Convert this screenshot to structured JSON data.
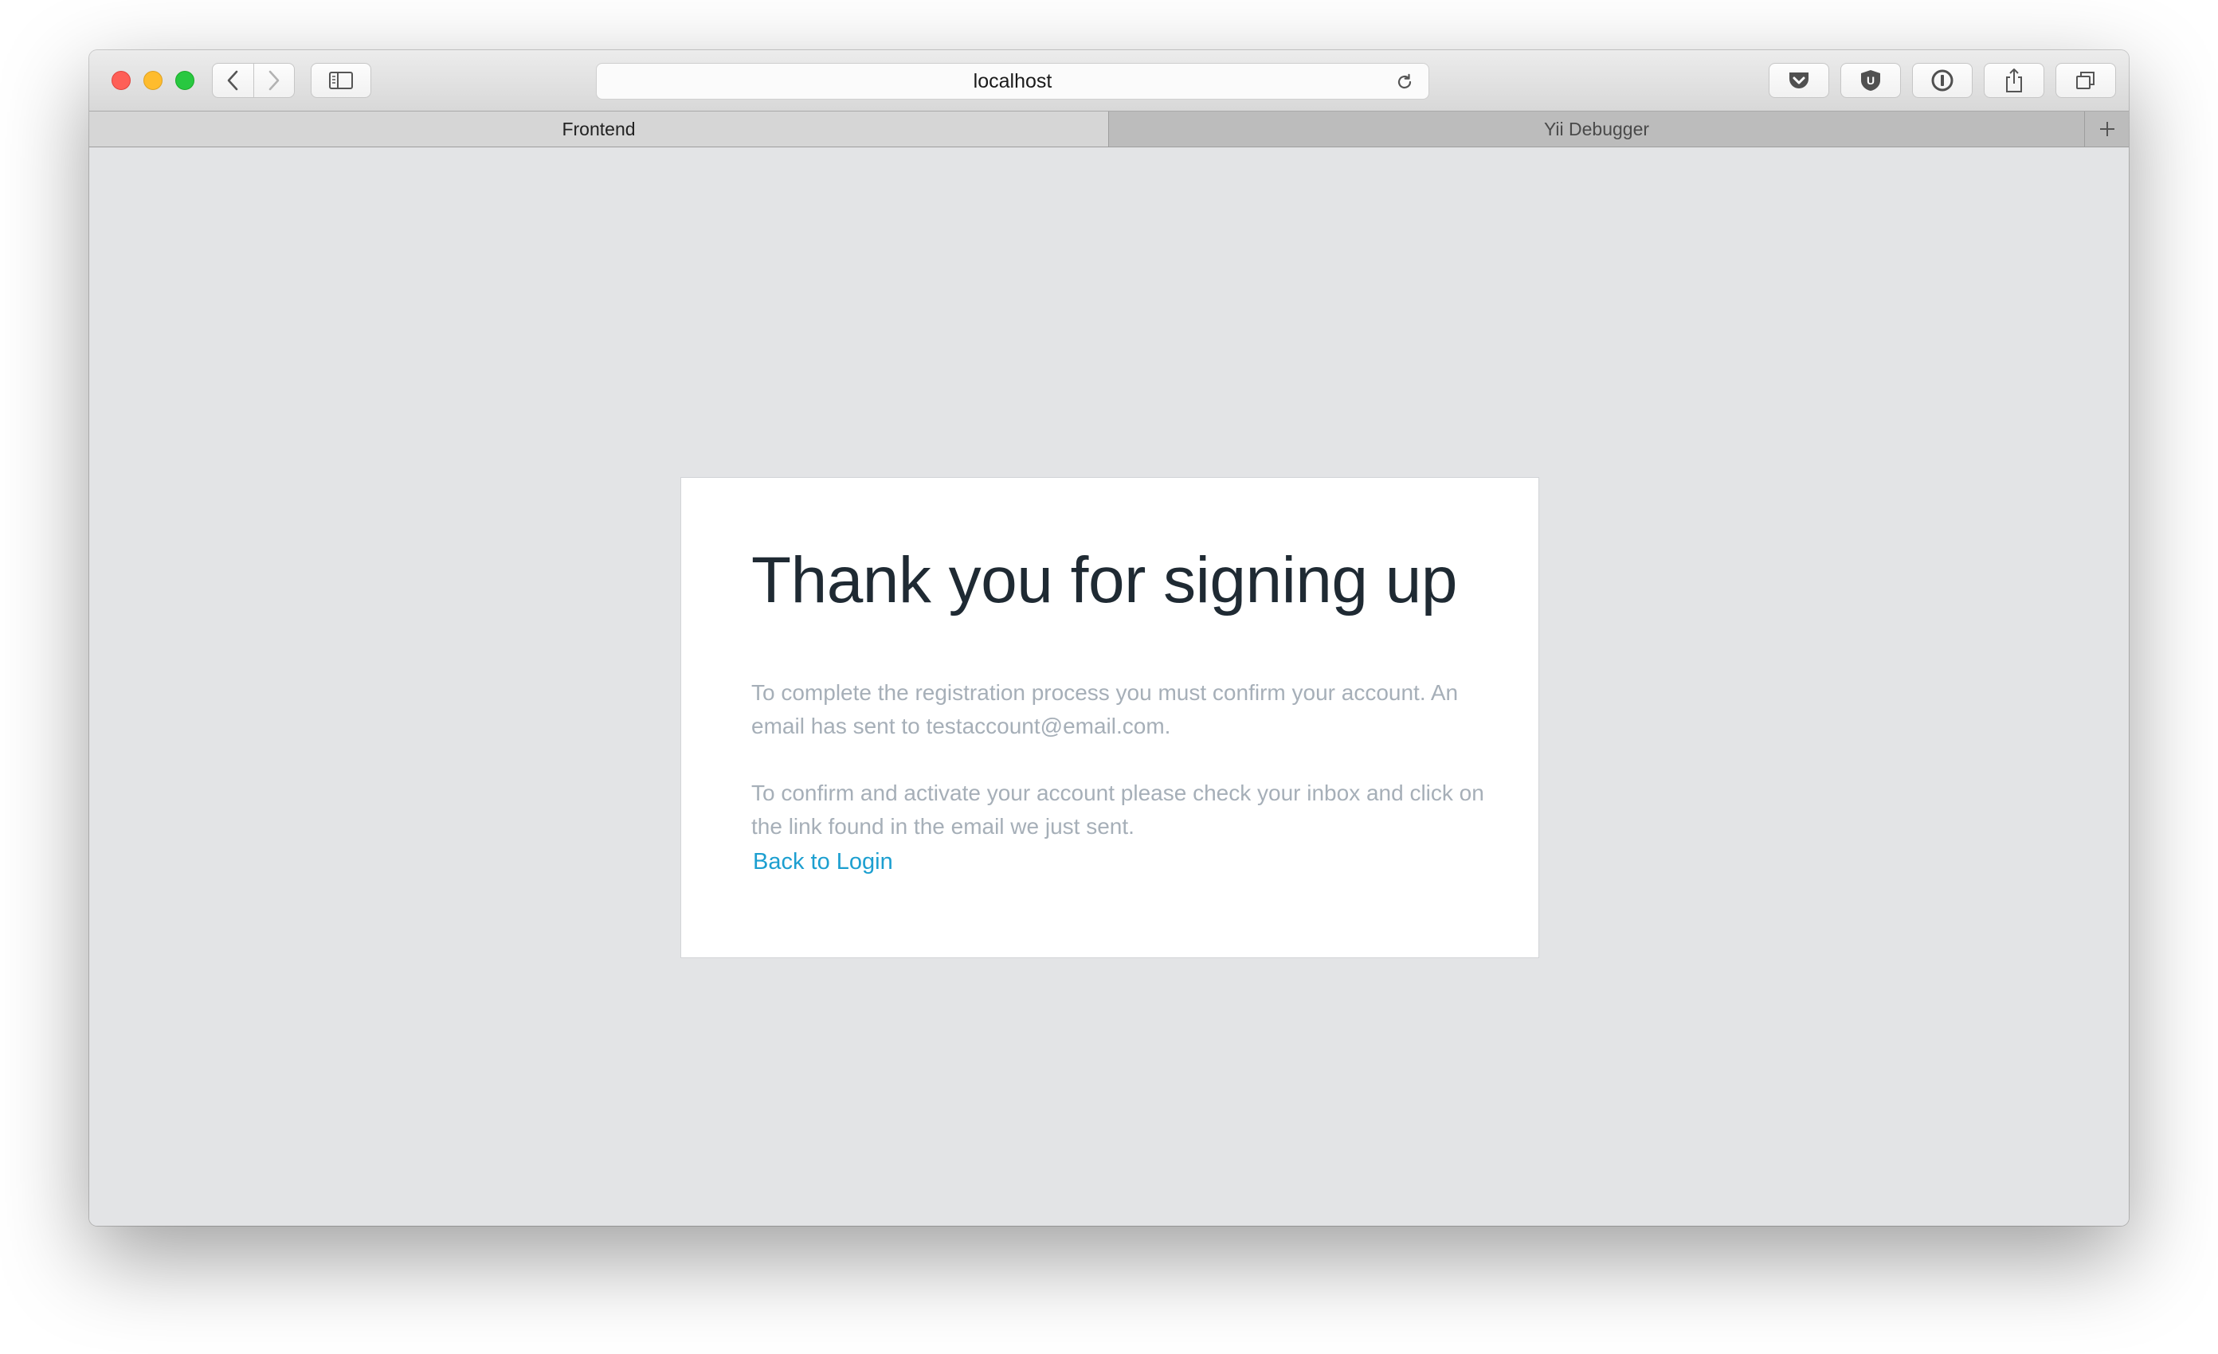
{
  "browser": {
    "address": "localhost",
    "tabs": [
      {
        "label": "Frontend",
        "active": true
      },
      {
        "label": "Yii Debugger",
        "active": false
      }
    ],
    "toolbar_icons": [
      "pocket-icon",
      "ublock-icon",
      "1password-icon",
      "share-icon",
      "tabs-overview-icon"
    ]
  },
  "page": {
    "title": "Thank you for signing up",
    "paragraph1": "To complete the registration process you must confirm your account. An email has sent to testaccount@email.com.",
    "paragraph2": "To confirm and activate your account please check your inbox and click on the link found in the email we just sent.",
    "back_link": "Back to Login"
  },
  "colors": {
    "background": "#e3e4e6",
    "title": "#1f2a33",
    "muted_text": "#a6afb8",
    "link": "#1c9fd0"
  }
}
